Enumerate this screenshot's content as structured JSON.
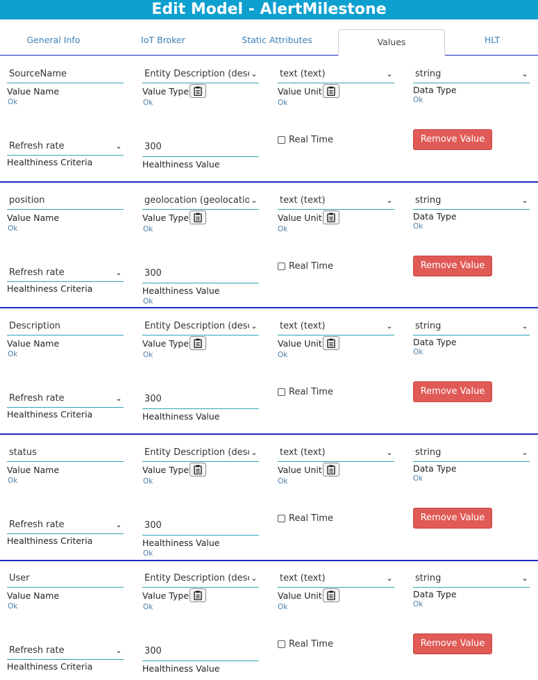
{
  "header": {
    "title": "Edit Model - AlertMilestone"
  },
  "tabs": [
    {
      "label": "General Info"
    },
    {
      "label": "IoT Broker"
    },
    {
      "label": "Static Attributes"
    },
    {
      "label": "Values",
      "active": true
    },
    {
      "label": "HLT"
    }
  ],
  "labels": {
    "value_name": "Value Name",
    "value_type": "Value Type",
    "value_unit": "Value Unit",
    "data_type": "Data Type",
    "healthiness_criteria": "Healthiness Criteria",
    "healthiness_value": "Healthiness Value",
    "real_time": "Real Time",
    "remove_value": "Remove Value",
    "ok": "Ok"
  },
  "values": [
    {
      "value_name": "SourceName",
      "value_type": "Entity Description (desc",
      "value_unit": "text (text)",
      "data_type": "string",
      "healthiness_criteria": "Refresh rate",
      "healthiness_value": "300",
      "real_time": false,
      "show_hv_ok": false
    },
    {
      "value_name": "position",
      "value_type": "geolocation (geolocatio",
      "value_unit": "text (text)",
      "data_type": "string",
      "healthiness_criteria": "Refresh rate",
      "healthiness_value": "300",
      "real_time": false,
      "show_hv_ok": true
    },
    {
      "value_name": "Description",
      "value_type": "Entity Description (desc",
      "value_unit": "text (text)",
      "data_type": "string",
      "healthiness_criteria": "Refresh rate",
      "healthiness_value": "300",
      "real_time": false,
      "show_hv_ok": false
    },
    {
      "value_name": "status",
      "value_type": "Entity Description (desc",
      "value_unit": "text (text)",
      "data_type": "string",
      "healthiness_criteria": "Refresh rate",
      "healthiness_value": "300",
      "real_time": false,
      "show_hv_ok": true
    },
    {
      "value_name": "User",
      "value_type": "Entity Description (desc",
      "value_unit": "text (text)",
      "data_type": "string",
      "healthiness_criteria": "Refresh rate",
      "healthiness_value": "300",
      "real_time": false,
      "show_hv_ok": false
    }
  ],
  "icons": {
    "select_arrow": "chevron-down-icon",
    "clipboard": "clipboard-icon"
  },
  "colors": {
    "header_bg": "#0da0cf",
    "separator": "#1a2bbf",
    "remove_button": "#e05a56",
    "ok_text": "#4d7fa8",
    "field_underline": "#2f9fb7"
  }
}
